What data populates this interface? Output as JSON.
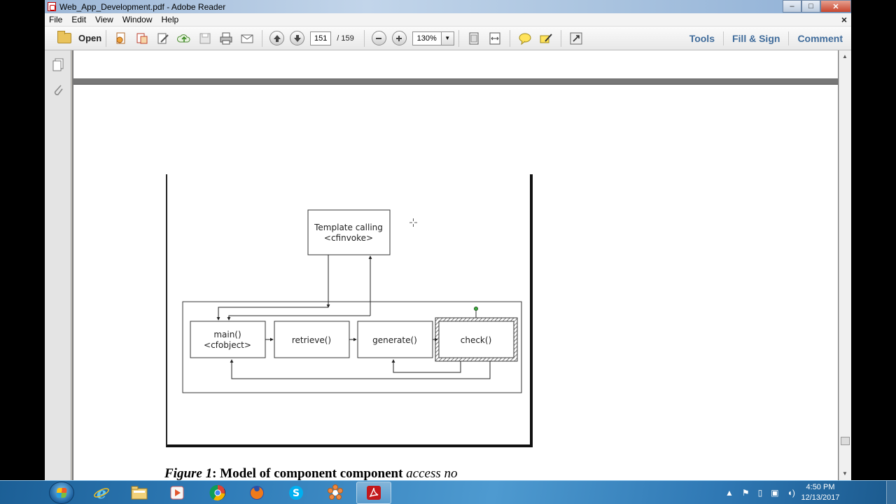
{
  "window": {
    "title": "Web_App_Development.pdf - Adobe Reader",
    "min_label": "–",
    "max_label": "□",
    "close_label": "✕"
  },
  "menu": {
    "items": [
      "File",
      "Edit",
      "View",
      "Window",
      "Help"
    ],
    "close_label": "×"
  },
  "toolbar": {
    "open_label": "Open",
    "page_current": "151",
    "page_total": "/ 159",
    "zoom": "130%",
    "tools_label": "Tools",
    "fill_sign_label": "Fill & Sign",
    "comment_label": "Comment"
  },
  "figure": {
    "template_line1": "Template calling",
    "template_line2": "<cfinvoke>",
    "main_line1": "main()",
    "main_line2": "<cfobject>",
    "retrieve": "retrieve()",
    "generate": "generate()",
    "check": "check()"
  },
  "caption": {
    "fig": "Figure 1",
    "text": ": Model of component component ",
    "tail": "access  no"
  },
  "taskbar": {
    "time": "4:50 PM",
    "date": "12/13/2017"
  },
  "colors": {
    "accent_link": "#3f6b9a",
    "taskbar": "#2f7cb8",
    "title_bar": "#a9c3df"
  }
}
